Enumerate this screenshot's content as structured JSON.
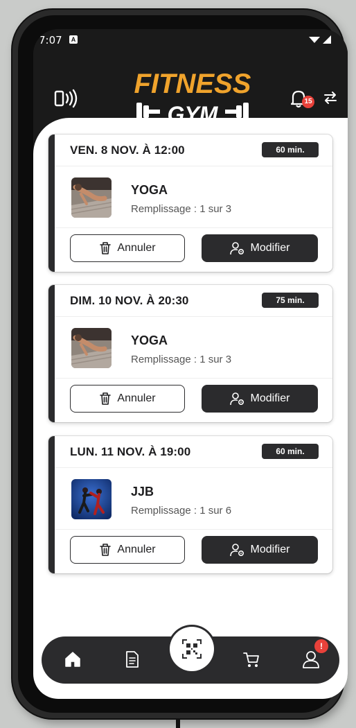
{
  "status_bar": {
    "time": "7:07",
    "notification_icon": "A"
  },
  "header": {
    "logo_top": "FITNESS",
    "logo_bottom": "GYM",
    "notification_count": "15",
    "colors": {
      "logo_orange": "#f0a32c",
      "background": "#1a1a1a"
    }
  },
  "bookings": [
    {
      "date": "VEN. 8 NOV. À 12:00",
      "duration": "60 min.",
      "activity": "YOGA",
      "filling": "Remplissage : 1 sur 3",
      "cancel_label": "Annuler",
      "modify_label": "Modifier",
      "thumb": "yoga"
    },
    {
      "date": "DIM. 10 NOV. À 20:30",
      "duration": "75 min.",
      "activity": "YOGA",
      "filling": "Remplissage : 1 sur 3",
      "cancel_label": "Annuler",
      "modify_label": "Modifier",
      "thumb": "yoga"
    },
    {
      "date": "LUN. 11 NOV. À 19:00",
      "duration": "60 min.",
      "activity": "JJB",
      "filling": "Remplissage : 1 sur 6",
      "cancel_label": "Annuler",
      "modify_label": "Modifier",
      "thumb": "jjb"
    }
  ],
  "bottom_nav": {
    "items": [
      "home-icon",
      "document-icon",
      "qr-code-icon",
      "cart-icon",
      "profile-icon"
    ],
    "profile_badge": "!"
  }
}
